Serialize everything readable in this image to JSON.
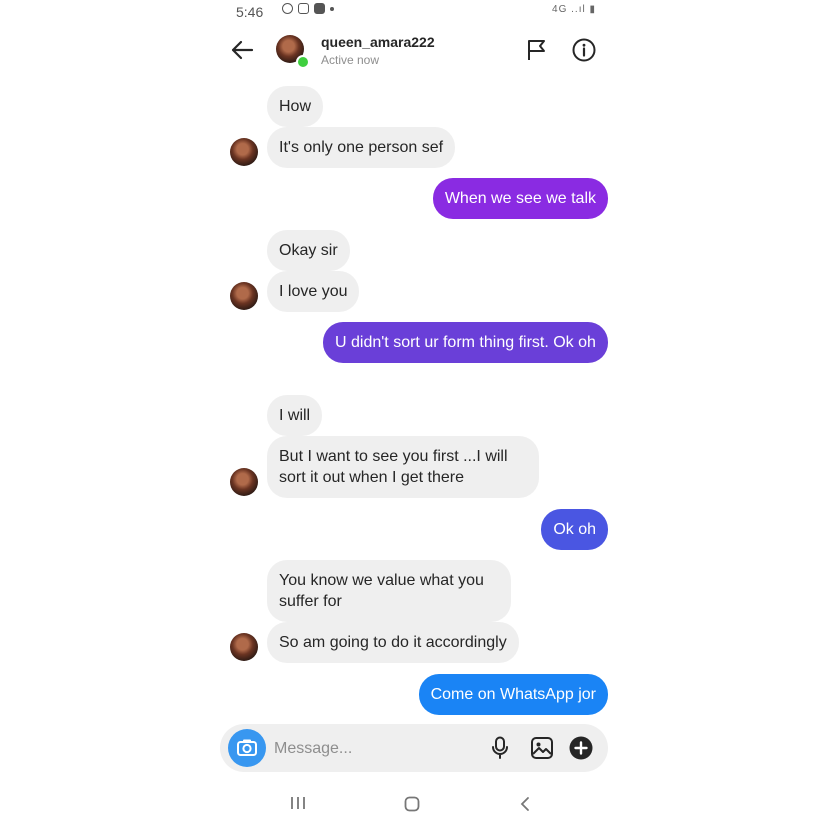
{
  "status_bar": {
    "time": "5:46",
    "right_indicators": "4G ..ıl ▮"
  },
  "header": {
    "username": "queen_amara222",
    "status": "Active now"
  },
  "messages": [
    {
      "from": "them",
      "text": "How"
    },
    {
      "from": "them",
      "text": "It's only one person sef"
    },
    {
      "from": "me",
      "text": "When we see we talk",
      "color": "#8a2be2"
    },
    {
      "from": "them",
      "text": "Okay sir"
    },
    {
      "from": "them",
      "text": "I love you"
    },
    {
      "from": "me",
      "text": "U didn't sort ur form thing first. Ok oh",
      "color": "#6a3fd8"
    },
    {
      "from": "them",
      "text": "I will"
    },
    {
      "from": "them",
      "text": "But I want to see you first ...I will sort it out when I get there"
    },
    {
      "from": "me",
      "text": "Ok oh",
      "color": "#4a56e2"
    },
    {
      "from": "them",
      "text": "You know we value what you suffer for"
    },
    {
      "from": "them",
      "text": "So am going to do it accordingly"
    },
    {
      "from": "me",
      "text": "Come on WhatsApp jor",
      "color": "#1a84f5"
    }
  ],
  "composer": {
    "placeholder": "Message..."
  },
  "icons": {
    "back": "arrow-left-icon",
    "flag": "flag-icon",
    "info": "info-icon",
    "camera": "camera-icon",
    "mic": "mic-icon",
    "gallery": "gallery-icon",
    "add": "plus-icon"
  },
  "colors": {
    "accent": "#3897f0",
    "online": "#3fcf3f",
    "incoming_bg": "#efefef"
  }
}
